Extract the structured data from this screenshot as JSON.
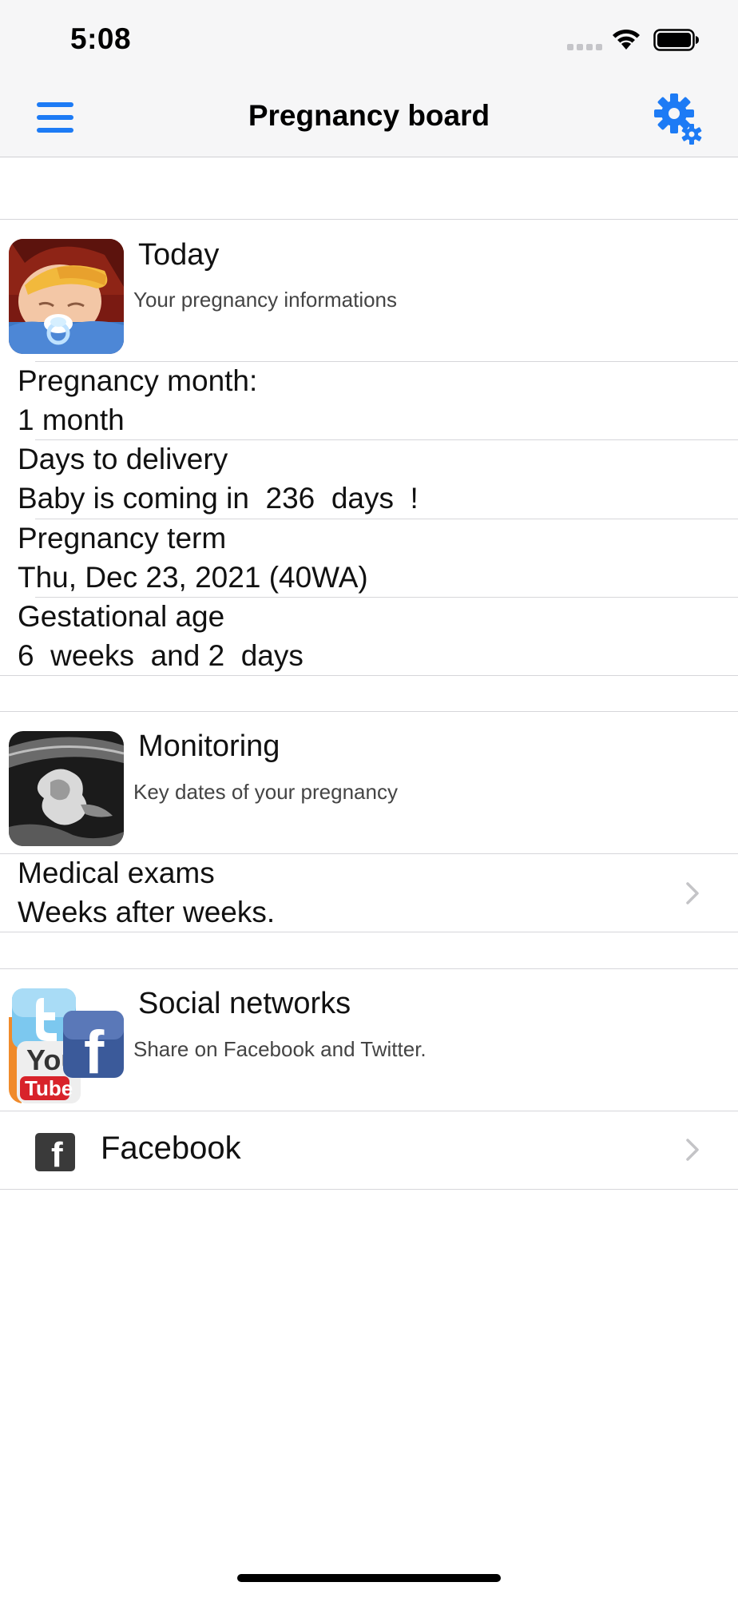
{
  "status_bar": {
    "time": "5:08"
  },
  "nav": {
    "title": "Pregnancy board",
    "menu_icon": "hamburger-menu-icon",
    "settings_icon": "gear-icon"
  },
  "colors": {
    "accent": "#1d7bf5",
    "bar_background": "#f6f6f7",
    "separator": "#d6d6da"
  },
  "today": {
    "title": "Today",
    "subtitle": "Your pregnancy informations",
    "items": [
      {
        "label": "Pregnancy month:",
        "value": "1 month"
      },
      {
        "label": "Days to delivery",
        "value": "Baby is coming in  236  days  !"
      },
      {
        "label": "Pregnancy term",
        "value": "Thu, Dec 23, 2021 (40WA)"
      },
      {
        "label": "Gestational age",
        "value": "6  weeks  and 2  days"
      }
    ]
  },
  "monitoring": {
    "title": "Monitoring",
    "subtitle": "Key dates of your pregnancy",
    "row": {
      "title": "Medical exams",
      "subtitle": "Weeks after weeks."
    }
  },
  "social": {
    "title": "Social networks",
    "subtitle": "Share on Facebook and Twitter.",
    "thumb_text": {
      "you": "You",
      "tube": "Tube",
      "f": "f"
    },
    "facebook": {
      "label": "Facebook",
      "icon_glyph": "f"
    }
  }
}
